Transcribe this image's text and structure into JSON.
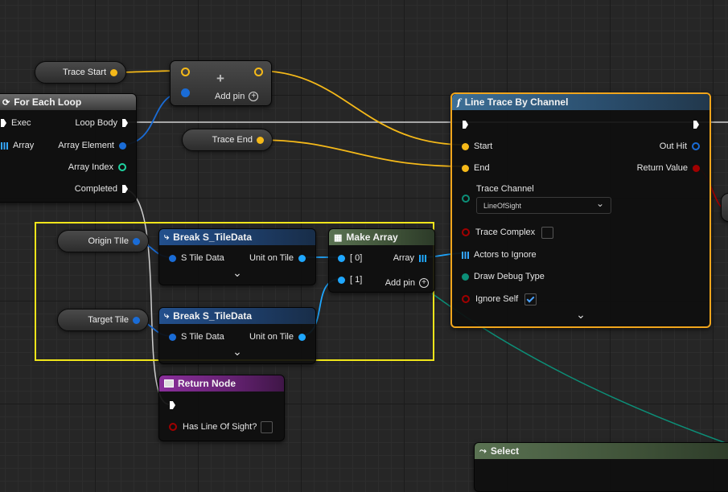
{
  "colors": {
    "exec": "#ffffff",
    "wire_vector": "#f5b919",
    "wire_struct": "#1a6cd6",
    "wire_bool": "#a10000",
    "wire_enum": "#0c8f78",
    "wire_object": "#1fa7ff",
    "selection_box": "#f0e51a",
    "selected_node_border": "#f0a51c"
  },
  "variables": {
    "trace_start": "Trace Start",
    "trace_end": "Trace End",
    "origin_tile": "Origin TIle",
    "target_tile": "Target Tile"
  },
  "make_vector": {
    "add_pin_label": "Add pin",
    "plus_glyph": "+"
  },
  "for_each_loop": {
    "title": "For Each Loop",
    "icon": "loop-icon",
    "exec_label": "Exec",
    "array_label": "Array",
    "loop_body_label": "Loop Body",
    "array_element_label": "Array Element",
    "array_index_label": "Array Index",
    "completed_label": "Completed"
  },
  "line_trace": {
    "title": "Line Trace By Channel",
    "icon": "function-icon",
    "icon_glyph": "f",
    "start_label": "Start",
    "end_label": "End",
    "trace_channel_label": "Trace Channel",
    "trace_channel_value": "LineOfSight",
    "trace_complex_label": "Trace Complex",
    "actors_to_ignore_label": "Actors to Ignore",
    "draw_debug_type_label": "Draw Debug Type",
    "ignore_self_label": "Ignore Self",
    "out_hit_label": "Out Hit",
    "return_value_label": "Return Value"
  },
  "break_tile_1": {
    "title": "Break S_TileData",
    "input_label": "S Tile Data",
    "output_label": "Unit on Tile"
  },
  "break_tile_2": {
    "title": "Break S_TileData",
    "input_label": "S Tile Data",
    "output_label": "Unit on Tile"
  },
  "make_array": {
    "title": "Make Array",
    "pin0_label": "[ 0]",
    "pin1_label": "[ 1]",
    "array_label": "Array",
    "add_pin_label": "Add pin"
  },
  "return_node": {
    "title": "Return Node",
    "has_los_label": "Has Line Of Sight?"
  },
  "select_node": {
    "title": "Select"
  },
  "icons": {
    "chevron": "⌄",
    "dropdown_arrow": "⌄",
    "break_glyph": "⤷",
    "make_array_glyph": "▦",
    "select_glyph": "⤳"
  }
}
